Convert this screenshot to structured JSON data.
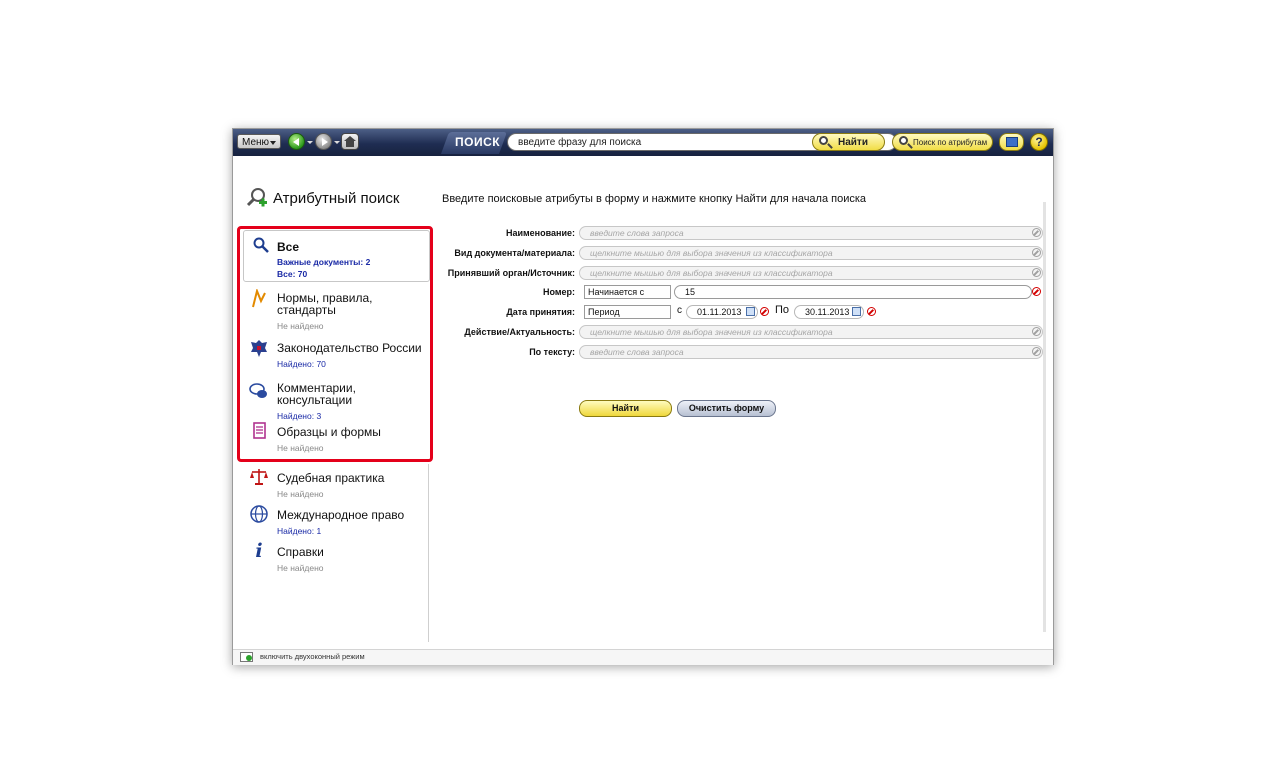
{
  "toolbar": {
    "menu_label": "Меню",
    "search_tab_label": "ПОИСК",
    "search_value": "введите фразу для поиска",
    "find_label": "Найти",
    "attr_search_label": "Поиск по атрибутам",
    "help_label": "?"
  },
  "panel_title": "Атрибутный поиск",
  "instruction": "Введите поисковые атрибуты в форму и нажмите кнопку Найти для начала поиска",
  "categories": [
    {
      "name": "Все",
      "important": "Важные документы: 2",
      "all": "Все: 70"
    },
    {
      "name_line1": "Нормы, правила,",
      "name_line2": "стандарты",
      "status": "Не найдено"
    },
    {
      "name": "Законодательство России",
      "status": "Найдено: 70"
    },
    {
      "name_line1": "Комментарии,",
      "name_line2": "консультации",
      "status": "Найдено: 3"
    },
    {
      "name": "Образцы и формы",
      "status": "Не найдено"
    },
    {
      "name": "Судебная практика",
      "status": "Не найдено"
    },
    {
      "name": "Международное право",
      "status": "Найдено: 1"
    },
    {
      "name": "Справки",
      "status": "Не найдено"
    }
  ],
  "form": {
    "name_label": "Наименование:",
    "name_placeholder": "введите слова запроса",
    "doc_type_label": "Вид документа/материала:",
    "doc_type_placeholder": "щелкните мышью для выбора значения из классификатора",
    "authority_label": "Принявший орган/Источник:",
    "authority_placeholder": "щелкните мышью для выбора значения из классификатора",
    "number_label": "Номер:",
    "number_mode": "Начинается с",
    "number_value": "15",
    "date_label": "Дата принятия:",
    "date_mode": "Период",
    "date_from_prefix": "с",
    "date_from": "01.11.2013",
    "date_to_prefix": "По",
    "date_to": "30.11.2013",
    "status_label": "Действие/Актуальность:",
    "status_placeholder": "щелкните мышью для выбора значения из классификатора",
    "text_label": "По тексту:",
    "text_placeholder": "введите слова запроса",
    "find_button": "Найти",
    "clear_button": "Очистить форму"
  },
  "statusbar": {
    "label": "включить двухоконный режим"
  },
  "colors": {
    "toolbar": "#1f2d52",
    "highlight_frame": "#e4001a",
    "found_link": "#1a2aa6",
    "button_yellow": "#f1dd45"
  },
  "icons": [
    "menu-caret-icon",
    "back-arrow-icon",
    "forward-arrow-icon",
    "home-icon",
    "magnifier-icon",
    "attr-search-icon",
    "settings-icon",
    "help-icon",
    "calendar-icon",
    "clear-icon"
  ]
}
